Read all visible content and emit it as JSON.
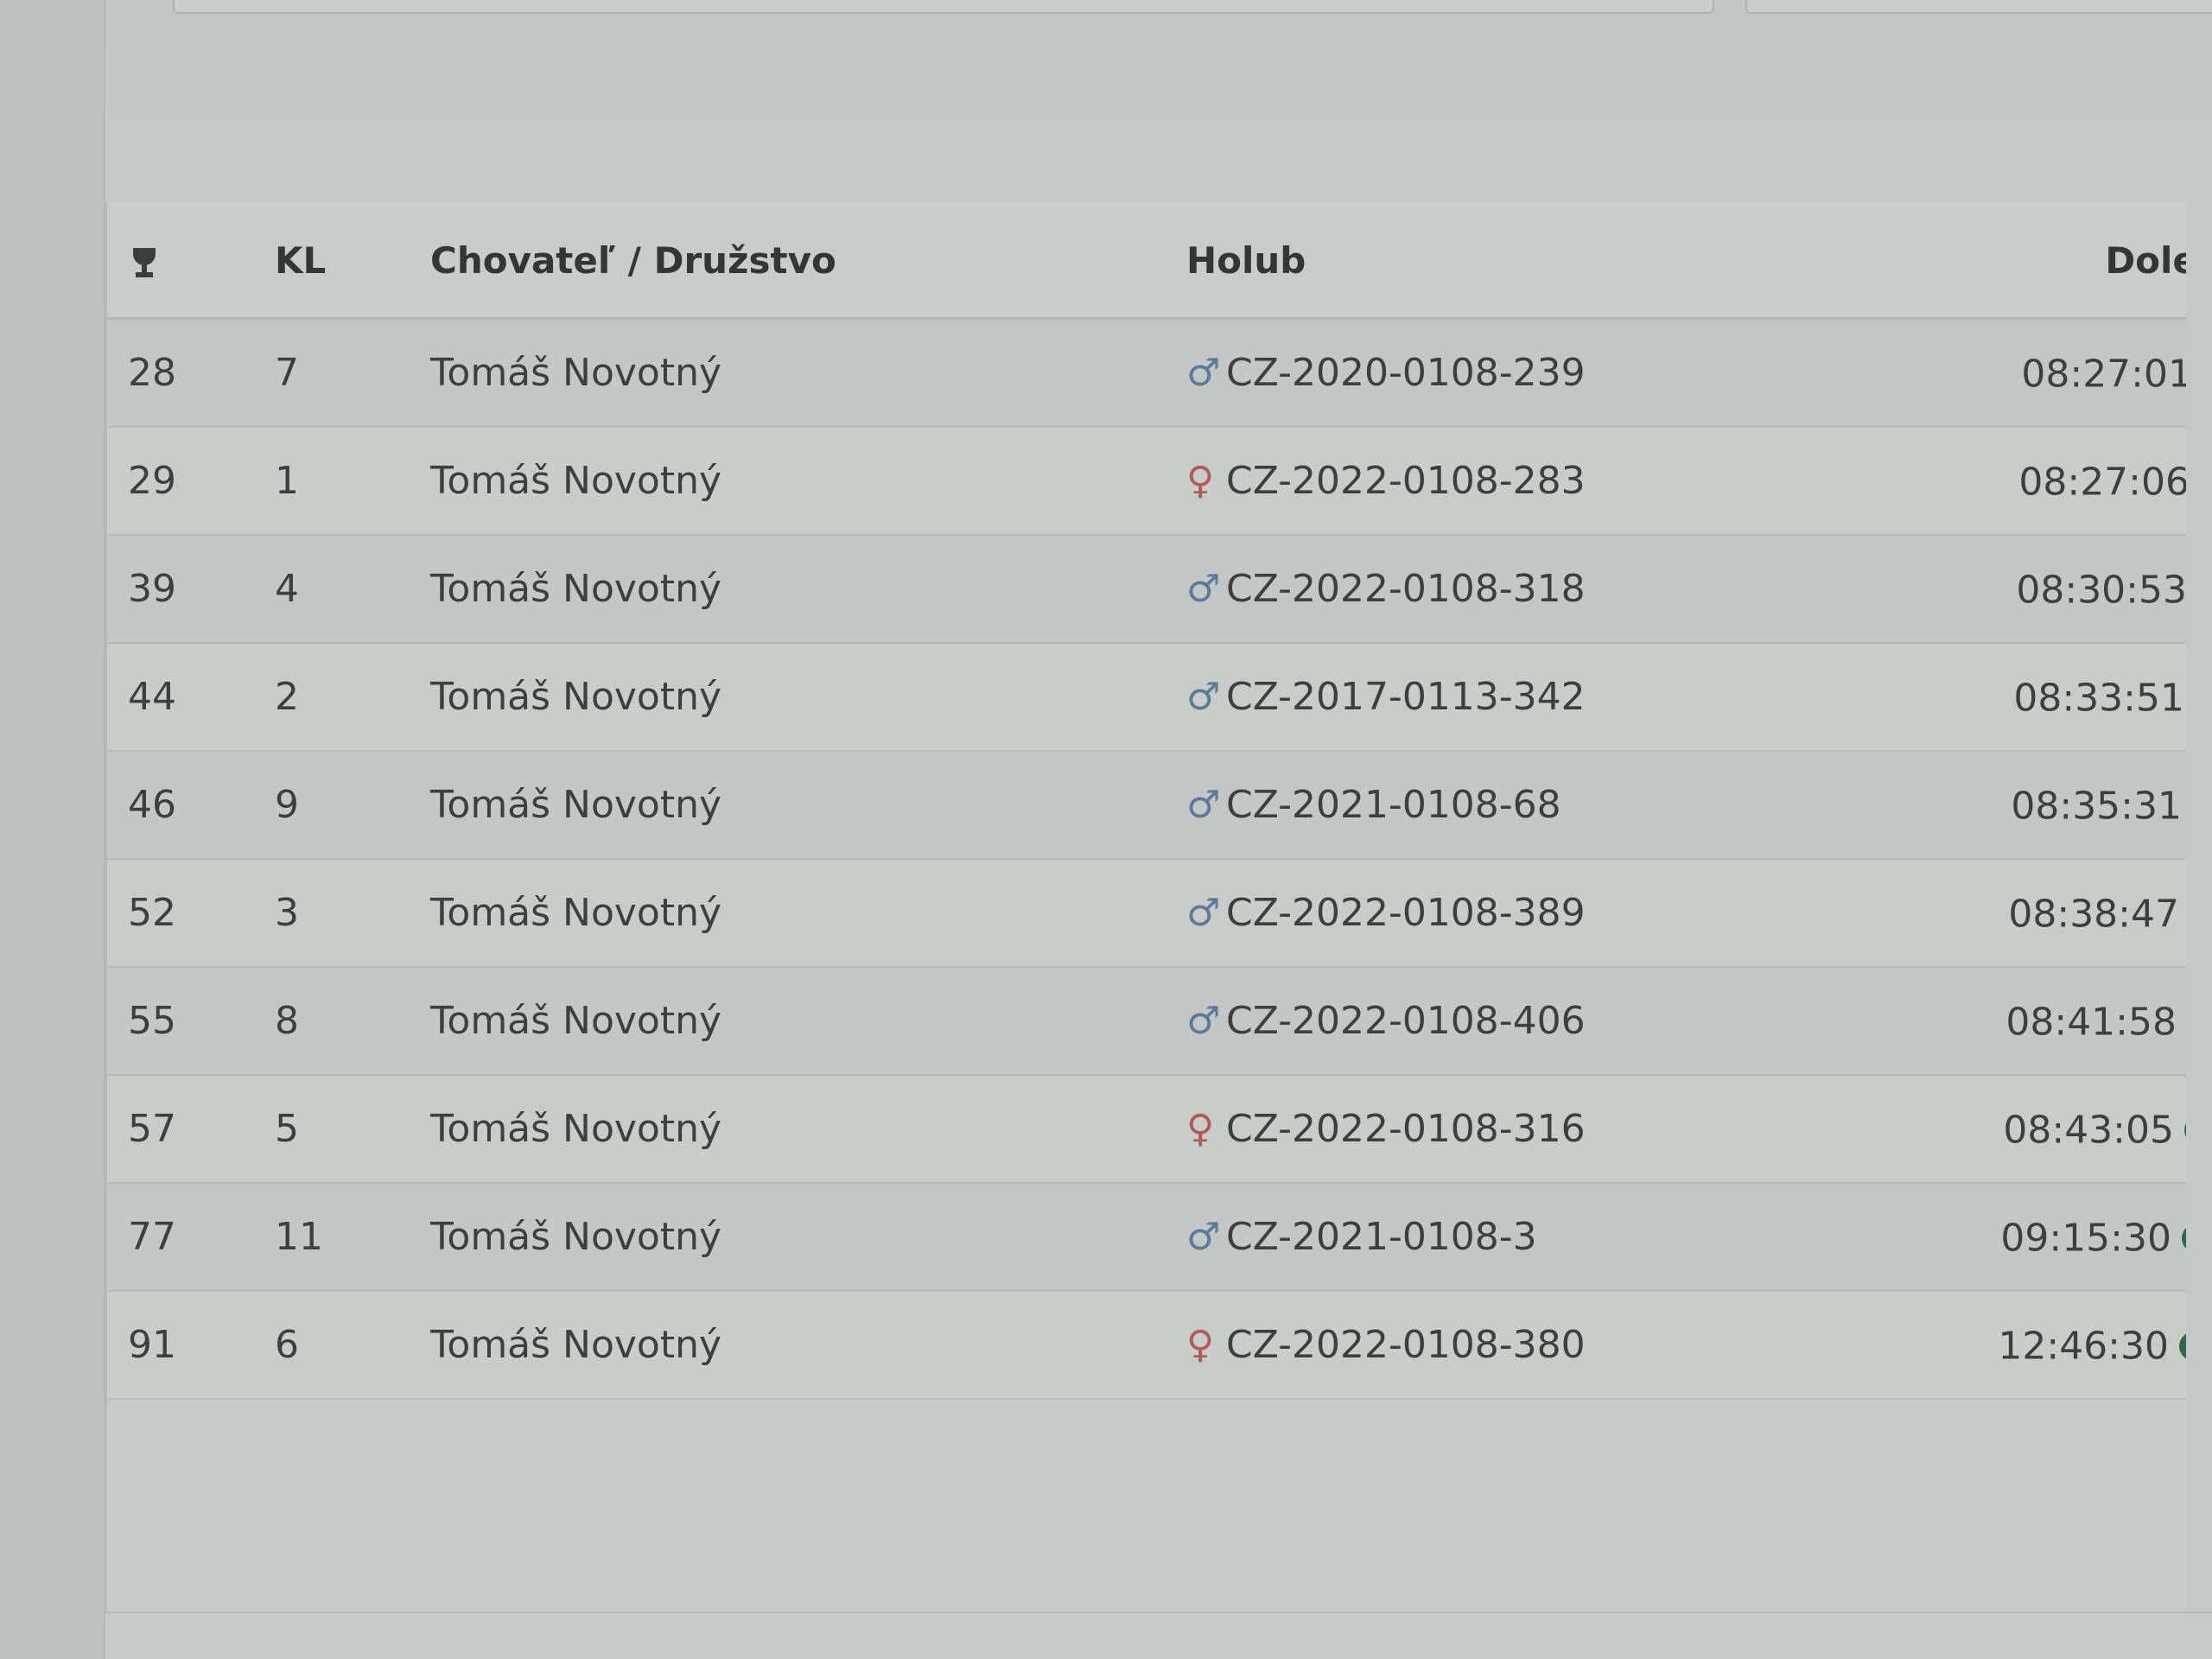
{
  "table": {
    "headers": {
      "rank": "",
      "kl": "KL",
      "breeder": "Chovateľ / Družstvo",
      "pigeon": "Holub",
      "dolet": "Dolet"
    },
    "rows": [
      {
        "rank": "28",
        "kl": "7",
        "breeder": "Tomáš Novotný",
        "sex": "male",
        "sex_symbol": "♂",
        "ring": "CZ-2020-0108-239",
        "dolet": "08:27:01"
      },
      {
        "rank": "29",
        "kl": "1",
        "breeder": "Tomáš Novotný",
        "sex": "female",
        "sex_symbol": "♀",
        "ring": "CZ-2022-0108-283",
        "dolet": "08:27:06"
      },
      {
        "rank": "39",
        "kl": "4",
        "breeder": "Tomáš Novotný",
        "sex": "male",
        "sex_symbol": "♂",
        "ring": "CZ-2022-0108-318",
        "dolet": "08:30:53"
      },
      {
        "rank": "44",
        "kl": "2",
        "breeder": "Tomáš Novotný",
        "sex": "male",
        "sex_symbol": "♂",
        "ring": "CZ-2017-0113-342",
        "dolet": "08:33:51"
      },
      {
        "rank": "46",
        "kl": "9",
        "breeder": "Tomáš Novotný",
        "sex": "male",
        "sex_symbol": "♂",
        "ring": "CZ-2021-0108-68",
        "dolet": "08:35:31"
      },
      {
        "rank": "52",
        "kl": "3",
        "breeder": "Tomáš Novotný",
        "sex": "male",
        "sex_symbol": "♂",
        "ring": "CZ-2022-0108-389",
        "dolet": "08:38:47"
      },
      {
        "rank": "55",
        "kl": "8",
        "breeder": "Tomáš Novotný",
        "sex": "male",
        "sex_symbol": "♂",
        "ring": "CZ-2022-0108-406",
        "dolet": "08:41:58"
      },
      {
        "rank": "57",
        "kl": "5",
        "breeder": "Tomáš Novotný",
        "sex": "female",
        "sex_symbol": "♀",
        "ring": "CZ-2022-0108-316",
        "dolet": "08:43:05"
      },
      {
        "rank": "77",
        "kl": "11",
        "breeder": "Tomáš Novotný",
        "sex": "male",
        "sex_symbol": "♂",
        "ring": "CZ-2021-0108-3",
        "dolet": "09:15:30"
      },
      {
        "rank": "91",
        "kl": "6",
        "breeder": "Tomáš Novotný",
        "sex": "female",
        "sex_symbol": "♀",
        "ring": "CZ-2022-0108-380",
        "dolet": "12:46:30"
      }
    ]
  },
  "icons": {
    "rank_header": "trophy-icon",
    "dolet_status": "dot-icon"
  },
  "colors": {
    "male": "#5b7a99",
    "female": "#b05a5a",
    "status_dot": "#2f6b4a"
  }
}
